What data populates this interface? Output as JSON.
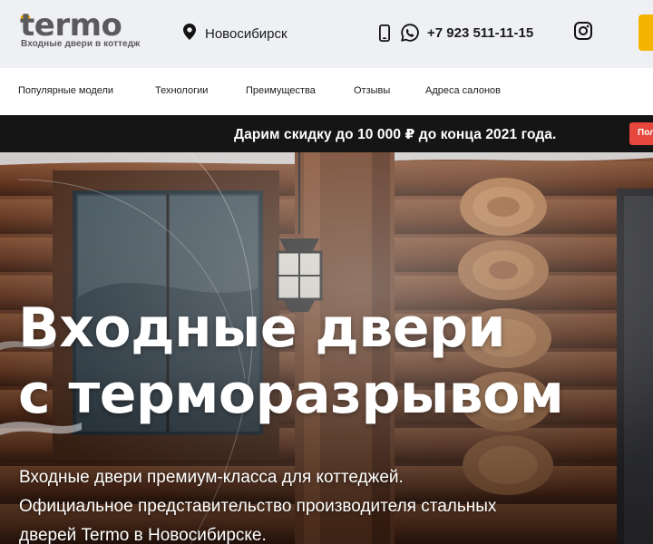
{
  "header": {
    "logo_word": "termo",
    "logo_tagline": "Входные двери в коттедж",
    "city": "Новосибирск",
    "phone": "+7 923 511-11-15"
  },
  "nav": {
    "items": [
      {
        "label": "Популярные модели"
      },
      {
        "label": "Технологии"
      },
      {
        "label": "Преимущества"
      },
      {
        "label": "Отзывы"
      },
      {
        "label": "Адреса салонов"
      }
    ]
  },
  "promo": {
    "text": "Дарим скидку до 10 000 ₽ до конца 2021 года.",
    "button_label": "Пол"
  },
  "hero": {
    "title_line1": "Входные двери",
    "title_line2": "с терморазрывом",
    "subtitle_line1": "Входные двери премиум-класса для коттеджей.",
    "subtitle_line2": "Официальное представительство производителя стальных",
    "subtitle_line3": "дверей Termo в Новосибирске."
  },
  "colors": {
    "accent": "#f5b400",
    "promo_bg": "#151515",
    "promo_button": "#e8473d",
    "topbar_bg": "#eef0f3"
  },
  "icons": [
    "location-pin-icon",
    "mobile-phone-icon",
    "whatsapp-icon",
    "instagram-icon"
  ]
}
